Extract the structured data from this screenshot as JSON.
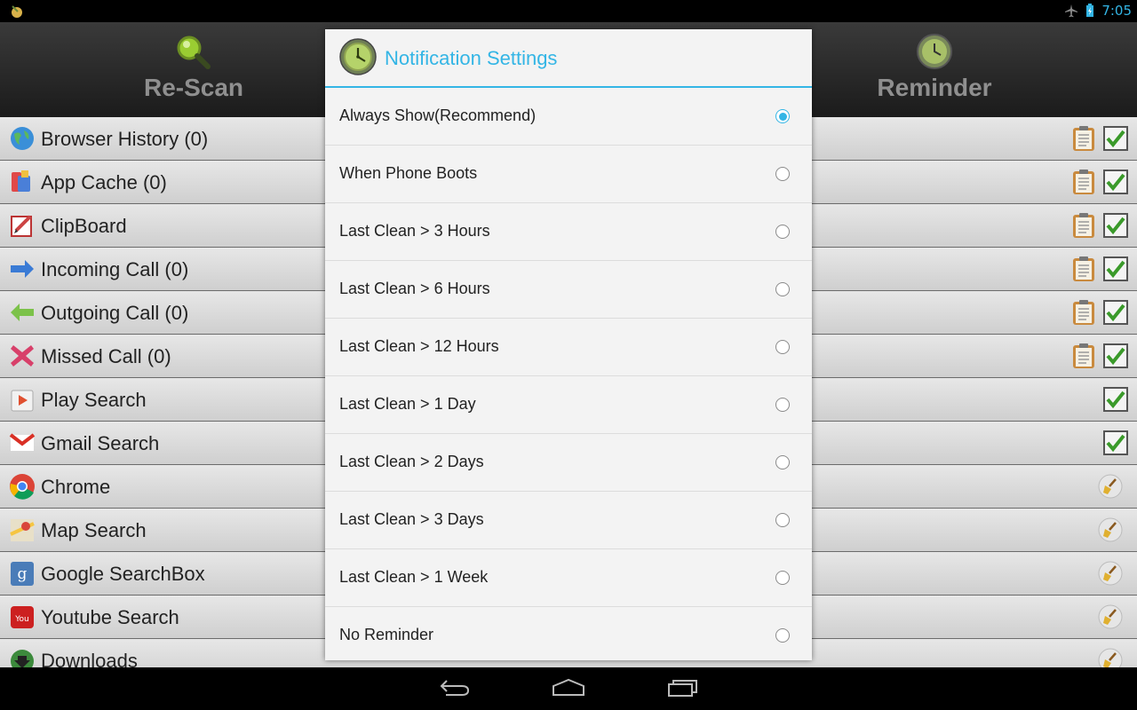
{
  "status": {
    "time": "7:05"
  },
  "header": {
    "rescan_label": "Re-Scan",
    "reminder_label": "Reminder"
  },
  "list": [
    {
      "label": "Browser History (0)",
      "icon": "globe-icon",
      "clipboard": true,
      "action": "check"
    },
    {
      "label": "App Cache (0)",
      "icon": "app-cache-icon",
      "clipboard": true,
      "action": "check"
    },
    {
      "label": "ClipBoard",
      "icon": "clipboard-pen-icon",
      "clipboard": true,
      "action": "check"
    },
    {
      "label": "Incoming Call (0)",
      "icon": "arrow-right-icon",
      "clipboard": true,
      "action": "check"
    },
    {
      "label": "Outgoing Call (0)",
      "icon": "arrow-left-icon",
      "clipboard": true,
      "action": "check"
    },
    {
      "label": "Missed Call (0)",
      "icon": "red-x-icon",
      "clipboard": true,
      "action": "check"
    },
    {
      "label": "Play Search",
      "icon": "play-store-icon",
      "clipboard": false,
      "action": "check"
    },
    {
      "label": "Gmail Search",
      "icon": "gmail-icon",
      "clipboard": false,
      "action": "check"
    },
    {
      "label": "Chrome",
      "icon": "chrome-icon",
      "clipboard": false,
      "action": "broom"
    },
    {
      "label": "Map Search",
      "icon": "maps-icon",
      "clipboard": false,
      "action": "broom"
    },
    {
      "label": "Google SearchBox",
      "icon": "google-search-icon",
      "clipboard": false,
      "action": "broom"
    },
    {
      "label": "Youtube Search",
      "icon": "youtube-icon",
      "clipboard": false,
      "action": "broom"
    },
    {
      "label": "Downloads",
      "icon": "download-icon",
      "clipboard": false,
      "action": "broom"
    }
  ],
  "dialog": {
    "title": "Notification Settings",
    "selected_index": 0,
    "options": [
      "Always Show(Recommend)",
      "When Phone Boots",
      "Last Clean > 3 Hours",
      "Last Clean > 6 Hours",
      "Last Clean > 12 Hours",
      "Last Clean > 1 Day",
      "Last Clean > 2 Days",
      "Last Clean > 3 Days",
      "Last Clean > 1 Week",
      "No Reminder"
    ]
  },
  "colors": {
    "accent": "#33b5e5",
    "header_text": "#8f8f8f",
    "check_green": "#4caf2a"
  }
}
